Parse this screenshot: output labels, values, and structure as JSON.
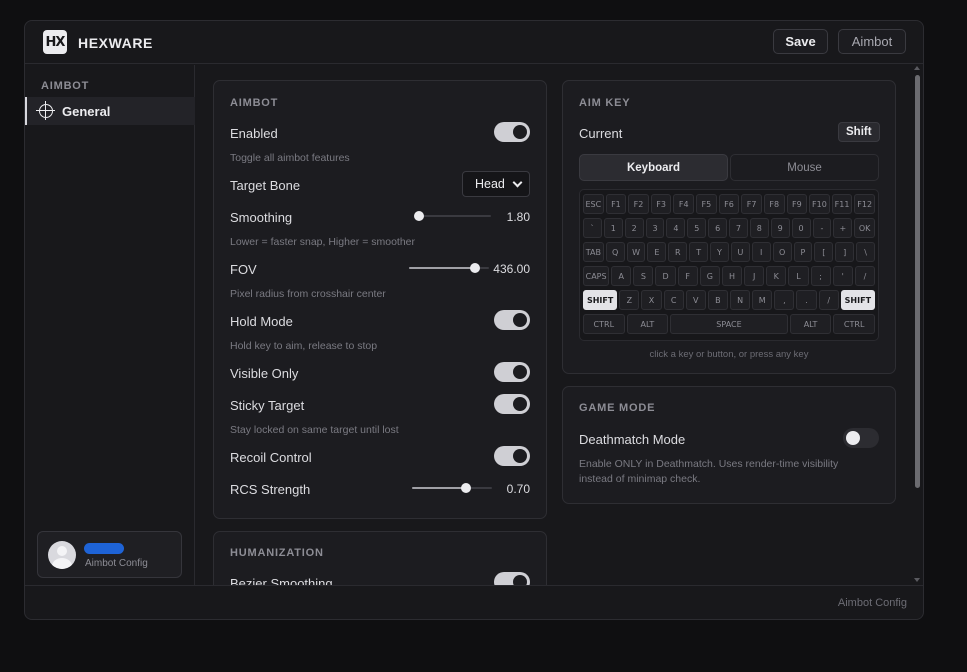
{
  "app": {
    "brand": "HEXWARE",
    "logo_text": "HX"
  },
  "toolbar": {
    "save_label": "Save",
    "aimbot_label": "Aimbot"
  },
  "sidebar": {
    "heading": "AIMBOT",
    "items": [
      {
        "label": "General",
        "icon": "crosshair-icon",
        "active": true
      }
    ],
    "profile": {
      "subtitle": "Aimbot Config"
    }
  },
  "aimbot": {
    "title": "AIMBOT",
    "enabled": {
      "label": "Enabled",
      "desc": "Toggle all aimbot features",
      "on": true
    },
    "target_bone": {
      "label": "Target Bone",
      "value": "Head"
    },
    "smoothing": {
      "label": "Smoothing",
      "value": "1.80",
      "fraction": 0.05,
      "desc": "Lower = faster snap, Higher = smoother"
    },
    "fov": {
      "label": "FOV",
      "value": "436.00",
      "fraction": 0.82,
      "desc": "Pixel radius from crosshair center"
    },
    "hold_mode": {
      "label": "Hold Mode",
      "desc": "Hold key to aim, release to stop",
      "on": true
    },
    "visible_only": {
      "label": "Visible Only",
      "on": true
    },
    "sticky_target": {
      "label": "Sticky Target",
      "desc": "Stay locked on same target until lost",
      "on": true
    },
    "recoil_control": {
      "label": "Recoil Control",
      "on": true
    },
    "rcs_strength": {
      "label": "RCS Strength",
      "value": "0.70",
      "fraction": 0.67
    }
  },
  "humanization": {
    "title": "HUMANIZATION",
    "bezier": {
      "label": "Bezier Smoothing",
      "on": true
    }
  },
  "aim_key": {
    "title": "AIM KEY",
    "current_label": "Current",
    "current_value": "Shift",
    "tabs": [
      "Keyboard",
      "Mouse"
    ],
    "active_tab": "Keyboard",
    "keyboard_rows": [
      [
        "ESC",
        "F1",
        "F2",
        "F3",
        "F4",
        "F5",
        "F6",
        "F7",
        "F8",
        "F9",
        "F10",
        "F11",
        "F12"
      ],
      [
        "`",
        "1",
        "2",
        "3",
        "4",
        "5",
        "6",
        "7",
        "8",
        "9",
        "0",
        "-",
        "+",
        "OK"
      ],
      [
        "TAB",
        "Q",
        "W",
        "E",
        "R",
        "T",
        "Y",
        "U",
        "I",
        "O",
        "P",
        "[",
        "]",
        "\\"
      ],
      [
        "CAPS",
        "A",
        "S",
        "D",
        "F",
        "G",
        "H",
        "J",
        "K",
        "L",
        ";",
        "'",
        "/"
      ],
      [
        "SHIFT",
        "Z",
        "X",
        "C",
        "V",
        "B",
        "N",
        "M",
        ",",
        ".",
        "/",
        "SHIFT"
      ],
      [
        "CTRL",
        "ALT",
        "SPACE",
        "ALT",
        "CTRL"
      ]
    ],
    "highlighted_key": "SHIFT",
    "hint": "click a key or button, or press any key"
  },
  "game_mode": {
    "title": "GAME MODE",
    "deathmatch": {
      "label": "Deathmatch Mode",
      "on": false,
      "desc_line1": "Enable ONLY in Deathmatch. Uses render-time visibility",
      "desc_line2": "instead of minimap check."
    }
  },
  "status": {
    "text": "Aimbot Config"
  }
}
